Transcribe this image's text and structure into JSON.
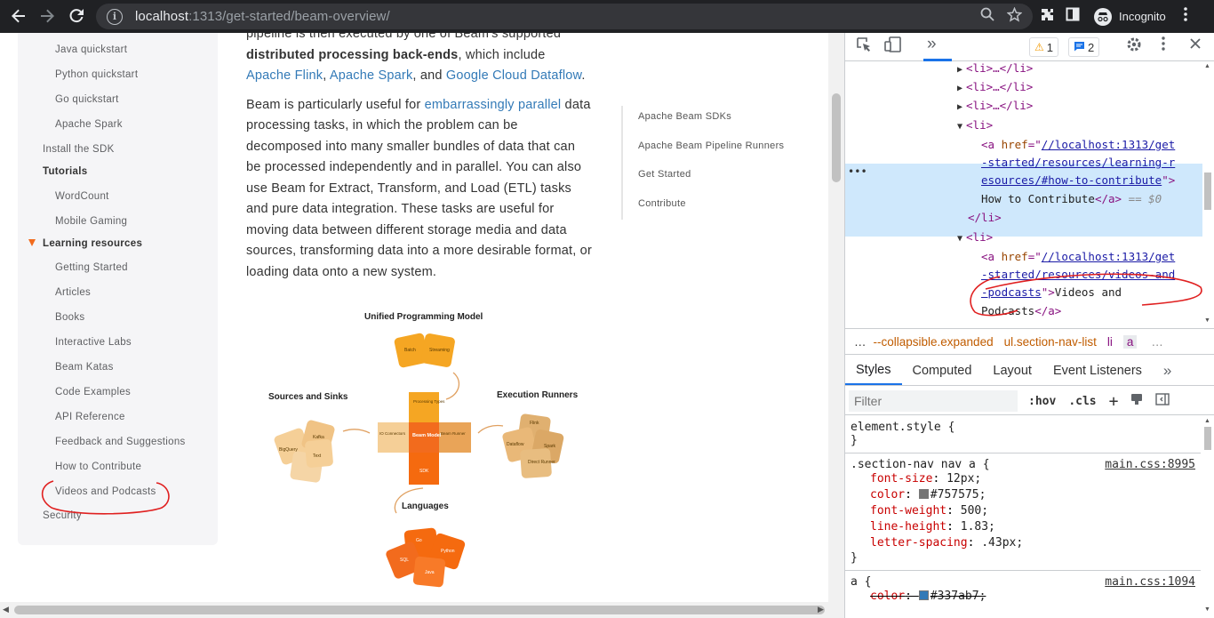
{
  "browser": {
    "url_host": "localhost",
    "url_path": ":1313/get-started/beam-overview/",
    "profile_label": "Incognito",
    "icons": [
      "back-icon",
      "forward-icon",
      "reload-icon",
      "site-info-icon",
      "zoom-icon",
      "bookmark-star-icon",
      "extensions-icon",
      "sidebar-icon",
      "incognito-icon",
      "menu-icon"
    ]
  },
  "sidebar": {
    "items": [
      {
        "label": "Java quickstart"
      },
      {
        "label": "Python quickstart"
      },
      {
        "label": "Go quickstart"
      },
      {
        "label": "Apache Spark"
      },
      {
        "label": "Install the SDK"
      },
      {
        "label": "Tutorials"
      },
      {
        "label": "WordCount"
      },
      {
        "label": "Mobile Gaming"
      },
      {
        "label": "Learning resources"
      },
      {
        "label": "Getting Started"
      },
      {
        "label": "Articles"
      },
      {
        "label": "Books"
      },
      {
        "label": "Interactive Labs"
      },
      {
        "label": "Beam Katas"
      },
      {
        "label": "Code Examples"
      },
      {
        "label": "API Reference"
      },
      {
        "label": "Feedback and Suggestions"
      },
      {
        "label": "How to Contribute"
      },
      {
        "label": "Videos and Podcasts"
      },
      {
        "label": "Security"
      }
    ]
  },
  "content": {
    "p1_prefix": "pipeline is then executed by one of Beam's supported ",
    "p1_bold": "distributed processing back-ends",
    "p1_mid": ", which include ",
    "p1_link1": "Apache Flink",
    "p1_sep1": ", ",
    "p1_link2": "Apache Spark",
    "p1_sep2": ", and ",
    "p1_link3": "Google Cloud Dataflow",
    "p1_end": ".",
    "p2_prefix": "Beam is particularly useful for ",
    "p2_link": "embarrassingly parallel",
    "p2_rest": " data processing tasks, in which the problem can be decomposed into many smaller bundles of data that can be processed independently and in parallel. You can also use Beam for Extract, Transform, and Load (ETL) tasks and pure data integration. These tasks are useful for moving data between different storage media and data sources, transforming data into a more desirable format, or loading data onto a new system."
  },
  "toc": {
    "items": [
      "Apache Beam SDKs",
      "Apache Beam Pipeline Runners",
      "Get Started",
      "Contribute"
    ]
  },
  "diagram": {
    "title_top": "Unified Programming Model",
    "label_left": "Sources and Sinks",
    "label_right": "Execution Runners",
    "label_bottom": "Languages",
    "top_pieces": [
      "Batch",
      "Streaming"
    ],
    "center_pieces": [
      "Processing Types",
      "IO Connectors",
      "Beam Model",
      "Beam Runner",
      "SDK"
    ],
    "left_pieces": [
      "BigQuery",
      "Kafka",
      "Text"
    ],
    "right_pieces": [
      "Flink",
      "Dataflow",
      "Spark",
      "Direct Runner"
    ],
    "bottom_pieces": [
      "Go",
      "SQL",
      "Java",
      "Python"
    ],
    "colors": {
      "yellow": "#f5a623",
      "orange": "#f26b1d",
      "beige": "#f5cf97",
      "tan": "#e9c28a",
      "deep": "#f56a0f"
    }
  },
  "devtools": {
    "issues_warn": "1",
    "issues_info": "2",
    "lines": {
      "li1": "<li>…</li>",
      "li2": "<li>…</li>",
      "li3": "<li>…</li>",
      "li4_open": "<li>",
      "a1_tag": "<a ",
      "a1_attr": "href",
      "a1_val_1": "//localhost:1313/get",
      "a1_val_2": "-started/resources/learning-r",
      "a1_val_3": "esources/#how-to-contribute",
      "a1_text": "How to Contribute",
      "a1_close": "</a>",
      "a1_eq": "== $0",
      "li4_close": "</li>",
      "li5_open": "<li>",
      "a2_tag": "<a ",
      "a2_attr": "href",
      "a2_val_1": "//localhost:1313/get",
      "a2_val_2": "-started/resources/videos-and",
      "a2_val_3": "-podcasts",
      "a2_text1": "Videos and",
      "a2_text2": "Podcasts",
      "a2_close": "</a>"
    },
    "breadcrumbs": [
      "--collapsible.expanded",
      "ul.section-nav-list",
      "li",
      "a"
    ],
    "subtabs": [
      "Styles",
      "Computed",
      "Layout",
      "Event Listeners"
    ],
    "filter_placeholder": "Filter",
    "hov": ":hov",
    "cls": ".cls",
    "styles": {
      "element_style": "element.style {",
      "close": "}",
      "rule1_selector": ".section-nav nav a {",
      "rule1_source": "main.css:8995",
      "rule1_decls": [
        {
          "name": "font-size",
          "value": "12px;"
        },
        {
          "name": "color",
          "value": "#757575;"
        },
        {
          "name": "font-weight",
          "value": "500;"
        },
        {
          "name": "line-height",
          "value": "1.83;"
        },
        {
          "name": "letter-spacing",
          "value": ".43px;"
        }
      ],
      "rule2_selector": "a {",
      "rule2_source": "main.css:1094",
      "rule2_decl_name": "color",
      "rule2_decl_value": "#337ab7;",
      "swatch_gray": "#757575",
      "swatch_blue": "#337ab7"
    }
  }
}
